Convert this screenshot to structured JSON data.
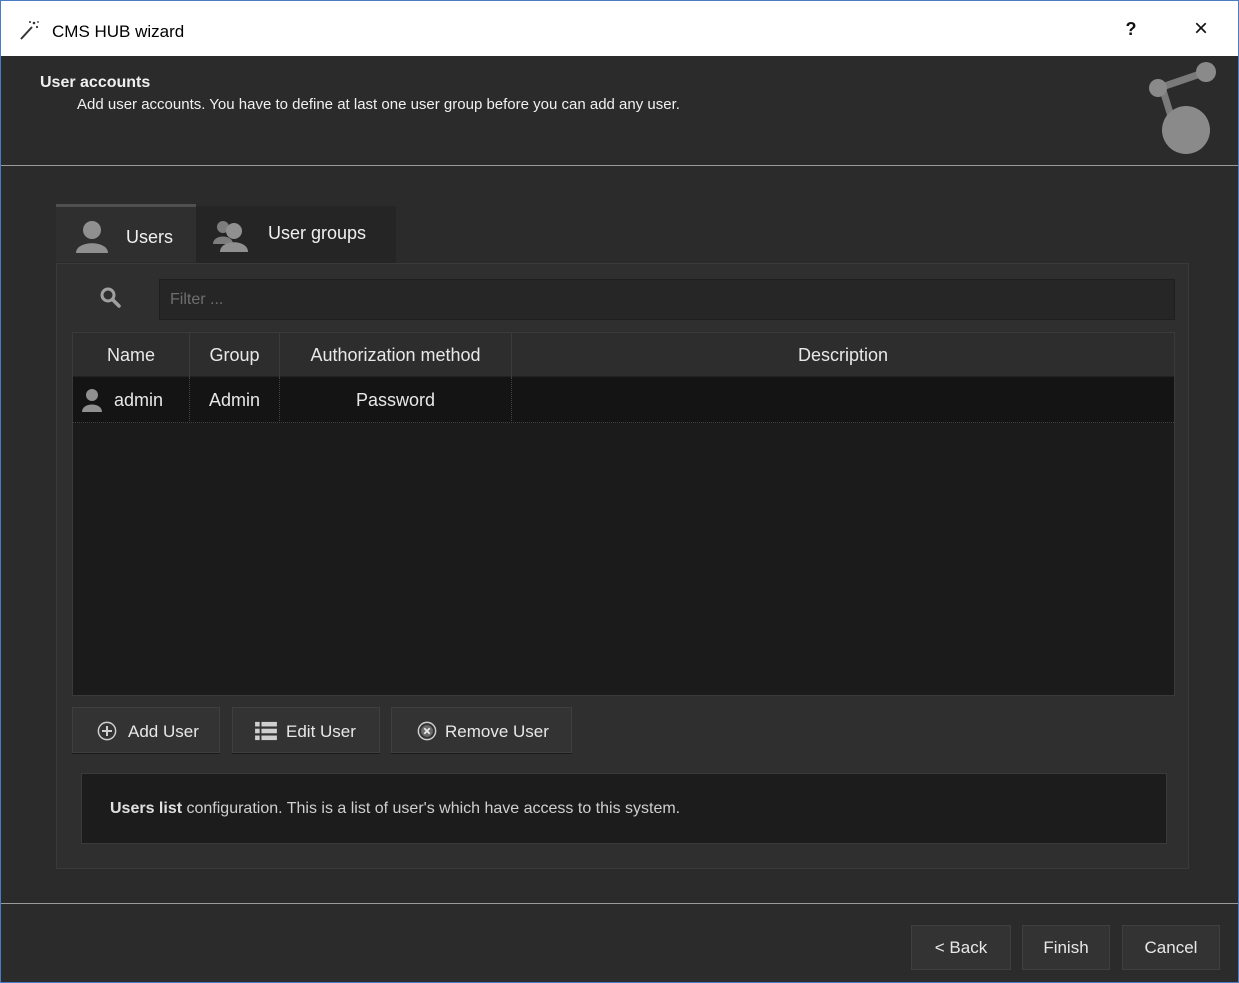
{
  "window": {
    "title": "CMS HUB wizard",
    "help_label": "?",
    "close_label": "×"
  },
  "header": {
    "title": "User accounts",
    "subtitle": "Add user accounts. You have to define at last one user group before you can add any user."
  },
  "tabs": [
    {
      "label": "Users",
      "icon": "user-icon",
      "active": true
    },
    {
      "label": "User groups",
      "icon": "user-group-icon",
      "active": false
    }
  ],
  "filter": {
    "placeholder": "Filter ...",
    "value": ""
  },
  "table": {
    "columns": [
      "Name",
      "Group",
      "Authorization method",
      "Description"
    ],
    "rows": [
      {
        "name": "admin",
        "group": "Admin",
        "auth": "Password",
        "description": ""
      }
    ]
  },
  "actions": {
    "add": "Add User",
    "edit": "Edit User",
    "remove": "Remove User"
  },
  "info": {
    "bold": "Users list",
    "text": " configuration. This is a list of user's which have access to this system."
  },
  "footer": {
    "back": "< Back",
    "finish": "Finish",
    "cancel": "Cancel"
  },
  "colors": {
    "background": "#2b2b2b",
    "table_background": "#1b1b1b",
    "titlebar": "#ffffff",
    "window_border": "#4a7cc4"
  }
}
